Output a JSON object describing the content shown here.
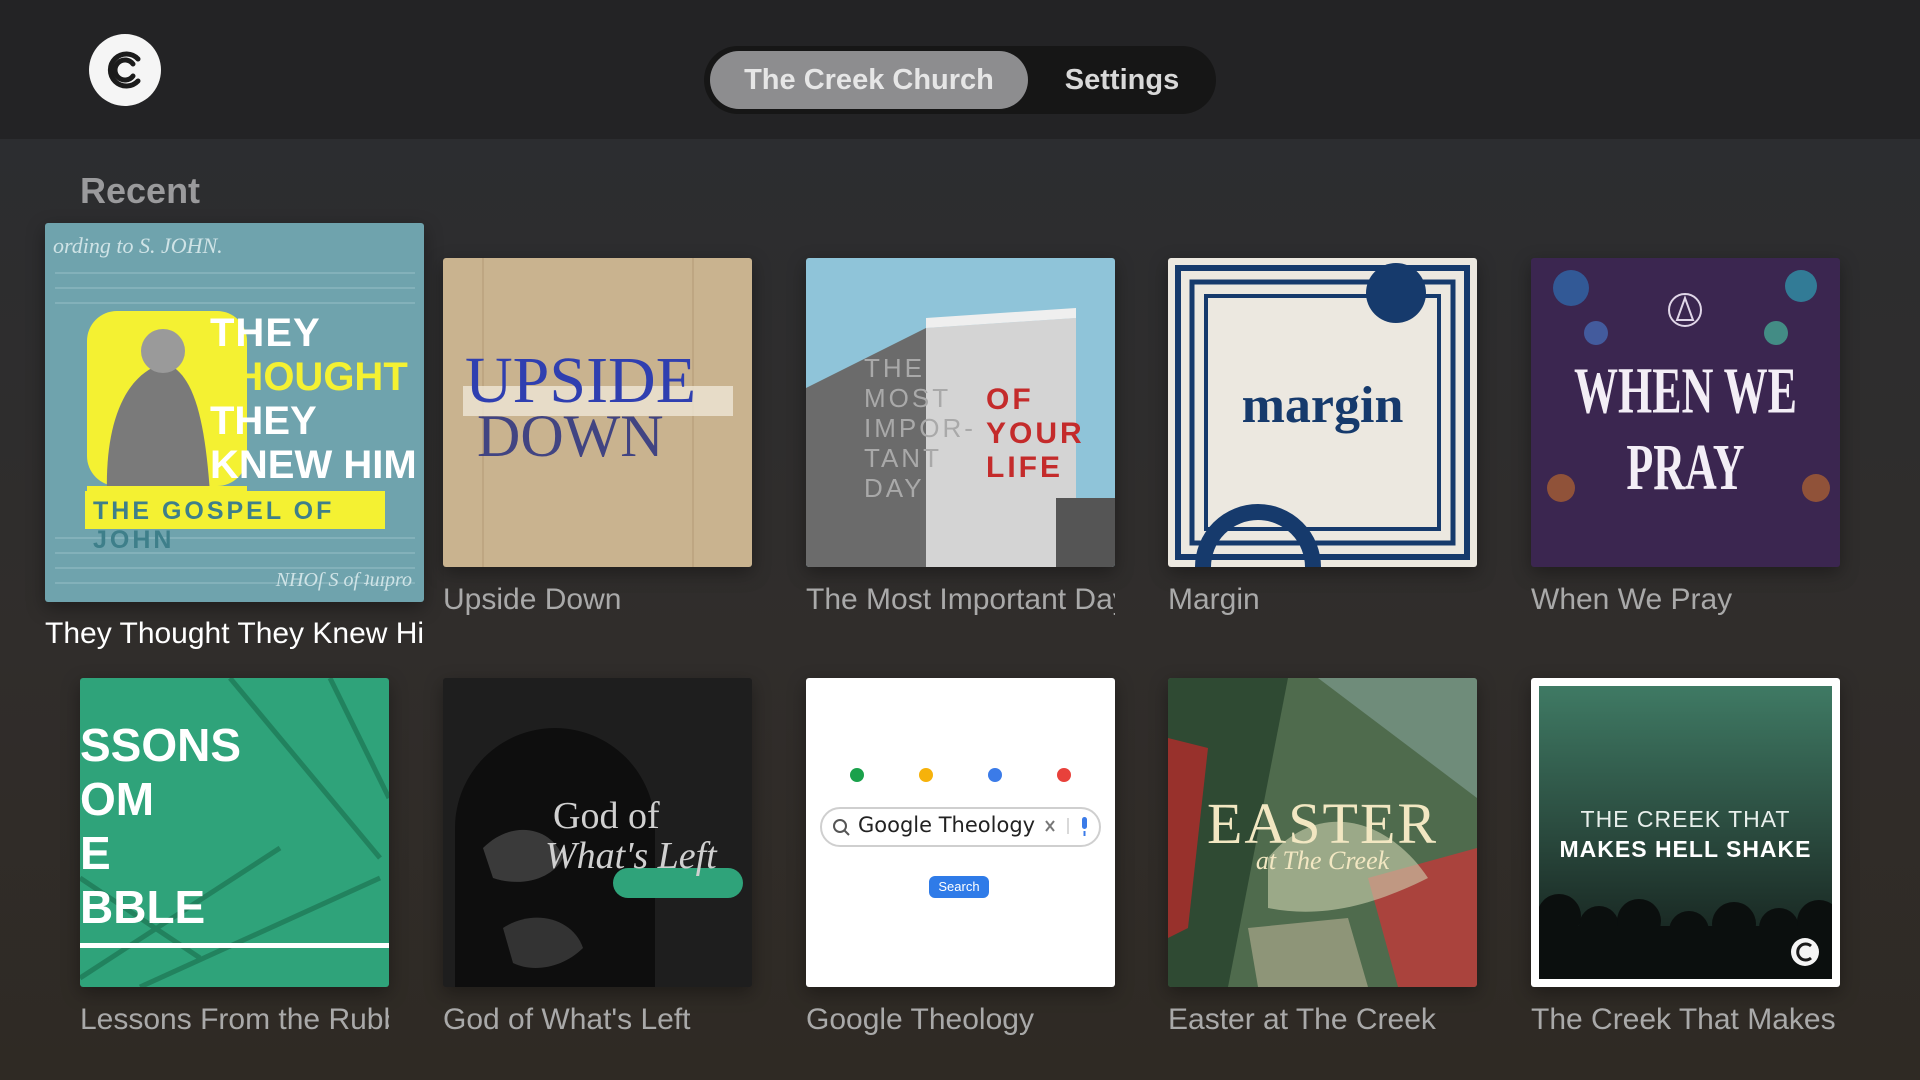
{
  "app": {
    "logo_icon": "creek-c-logo-icon",
    "tabs": [
      {
        "label": "The Creek Church",
        "selected": true
      },
      {
        "label": "Settings",
        "selected": false
      }
    ]
  },
  "section": {
    "title": "Recent"
  },
  "cards": [
    {
      "title": "They Thought They Knew Him",
      "art_lines": [
        "THEY",
        "THOUGHT",
        "THEY",
        "KNEW HIM"
      ],
      "art_sub": "THE GOSPEL OF JOHN",
      "art_top": "ording to S. JOHN.",
      "art_bottom": "NHOſ S of ʇuɪpro",
      "focused": true
    },
    {
      "title": "Upside Down",
      "art_lines": [
        "UPSIDE",
        "DOWN"
      ]
    },
    {
      "title": "The Most Important Day Of Your Life",
      "art_lines": [
        "THE",
        "MOST",
        "IMPOR-",
        "TANT",
        "DAY"
      ],
      "art_sub_lines": [
        "OF",
        "YOUR",
        "LIFE"
      ]
    },
    {
      "title": "Margin",
      "art_lines": [
        "margin"
      ]
    },
    {
      "title": "When We Pray",
      "art_lines": [
        "WHEN WE PRAY"
      ]
    },
    {
      "title": "Lessons From the Rubble",
      "art_lines": [
        "SSONS",
        "OM",
        "E",
        "BBLE"
      ]
    },
    {
      "title": "God of What's Left",
      "art_lines": [
        "God of",
        "What's Left"
      ]
    },
    {
      "title": "Google Theology",
      "art_search": "Google Theology",
      "art_button": "Search"
    },
    {
      "title": "Easter at The Creek",
      "art_lines": [
        "EASTER",
        "at The Creek"
      ]
    },
    {
      "title": "The Creek That Makes Hell Shake",
      "art_lines": [
        "THE CREEK THAT",
        "MAKES HELL SHAKE"
      ]
    }
  ],
  "colors": {
    "topbar": "#232325",
    "tab_active": "#8d8d8f",
    "accent_yellow": "#f4f132",
    "teal": "#6fa3ad",
    "green": "#2fa37a"
  }
}
